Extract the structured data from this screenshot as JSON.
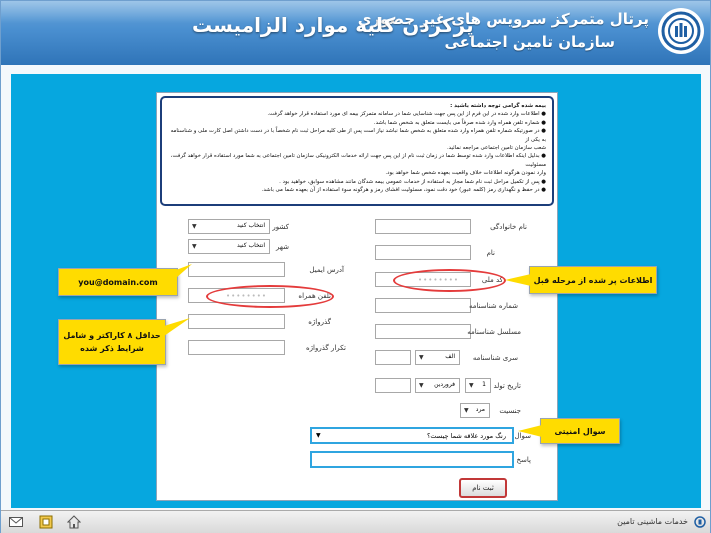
{
  "header": {
    "portal_title": "پرتال متمرکز سرویس های غیر حضوری",
    "org_title": "سازمان تامین اجتماعی",
    "banner_title": "پرکردن کلیه موارد الزامیست"
  },
  "notice": {
    "heading": "بیمه شده گرامی توجه داشته باشید :",
    "lines": [
      "● اطلاعات وارد شده در این فرم از این پس جهت شناسایی شما در سامانه متمرکز بیمه ای مورد استفاده قرار خواهد گرفت.",
      "● شماره تلفن همراه وارد شده صرفاً می بایست متعلق به شخص شما باشد.",
      "● در صورتیکه شماره تلفن همراه وارد شده متعلق به شخص شما نباشد نیاز است پس از طی کلیه مراحل ثبت نام شخصاً با در دست داشتن اصل کارت ملی و شناسنامه به یکی از",
      "شعب سازمان تامین اجتماعی مراجعه نمائید.",
      "● بدلیل اینکه اطلاعات وارد شده توسط شما در زمان ثبت نام از این پس جهت ارائه خدمات الکترونیکی سازمان تامین اجتماعی به شما مورد استفاده قرار خواهد گرفت، مسئولیت",
      "وارد نمودن هرگونه اطلاعات خلاف واقعیت بعهده شخص شما خواهد بود.",
      "● پس از تکمیل مراحل ثبت نام شما مجاز به استفاده از خدمات عمومی بیمه شدگان مانند مشاهده سوابق، خواهید بود .",
      "● در حفظ و نگهداری رمز (کلمه عبور) خود دقت نمود، مسئولیت افشای رمز و هرگونه سوء استفاده از آن بعهده شما می باشد."
    ]
  },
  "right_form": {
    "last_name_label": "نام خانوادگی",
    "first_name_label": "نام",
    "national_code_label": "کد ملی",
    "national_code_value": "••••••••",
    "id_number_label": "شماره شناسنامه",
    "id_serial_label": "مسلسل شناسنامه",
    "id_series_label": "سری شناسنامه",
    "id_series_value": "الف",
    "birth_date_label": "تاریخ تولد",
    "birth_day_value": "1",
    "birth_month_value": "فروردین",
    "gender_label": "جنسیت",
    "gender_value": "مرد"
  },
  "left_form": {
    "country_label": "کشور",
    "country_value": "انتخاب کنید",
    "city_label": "شهر",
    "city_value": "انتخاب کنید",
    "email_label": "آدرس ایمیل",
    "mobile_label": "تلفن همراه",
    "mobile_value": "••••••••",
    "password_label": "گذرواژه",
    "repeat_password_label": "تکرار گذرواژه"
  },
  "security": {
    "question_label": "سوال",
    "question_value": "رنگ مورد علاقه شما چیست؟",
    "answer_label": "پاسخ"
  },
  "submit_label": "ثبت نام",
  "callouts": {
    "prefilled": "اطلاعات پر شده از مرحله قبل",
    "email_example": "you@domain.com",
    "password_hint_1": "حداقل ۸ کاراکتر و شامل",
    "password_hint_2": "شرایط ذکر شده",
    "security_question": "سوال امنیتی"
  },
  "footer": {
    "label": "خدمات ماشینی تامین"
  },
  "colors": {
    "header_blue": "#3b82c6",
    "content_cyan": "#06a7df",
    "callout_yellow": "#ffdc00",
    "highlight_red": "#e43b3b"
  }
}
